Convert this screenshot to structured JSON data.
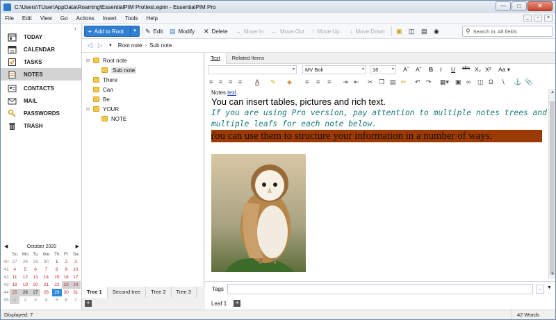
{
  "window": {
    "title": "C:\\Users\\TUser\\AppData\\Roaming\\EssentialPIM Pro\\test.epim - EssentialPIM Pro"
  },
  "menu": [
    "File",
    "Edit",
    "View",
    "Go",
    "Actions",
    "Insert",
    "Tools",
    "Help"
  ],
  "nav": [
    {
      "label": "TODAY",
      "icon": "today-icon"
    },
    {
      "label": "CALENDAR",
      "icon": "calendar-icon"
    },
    {
      "label": "TASKS",
      "icon": "tasks-icon"
    },
    {
      "label": "NOTES",
      "icon": "notes-icon"
    },
    {
      "label": "CONTACTS",
      "icon": "contacts-icon"
    },
    {
      "label": "MAIL",
      "icon": "mail-icon"
    },
    {
      "label": "PASSWORDS",
      "icon": "passwords-icon"
    },
    {
      "label": "TRASH",
      "icon": "trash-icon"
    }
  ],
  "calendar": {
    "title": "October  2020",
    "dow": [
      "Su",
      "Mo",
      "Tu",
      "We",
      "Th",
      "Fr",
      "Sa"
    ],
    "weeks": [
      {
        "wk": "40",
        "days": [
          "27",
          "28",
          "29",
          "30",
          "1",
          "2",
          "3"
        ]
      },
      {
        "wk": "41",
        "days": [
          "4",
          "5",
          "6",
          "7",
          "8",
          "9",
          "10"
        ]
      },
      {
        "wk": "42",
        "days": [
          "11",
          "12",
          "13",
          "14",
          "15",
          "16",
          "17"
        ]
      },
      {
        "wk": "43",
        "days": [
          "18",
          "19",
          "20",
          "21",
          "22",
          "23",
          "24"
        ]
      },
      {
        "wk": "44",
        "days": [
          "25",
          "26",
          "27",
          "28",
          "29",
          "30",
          "31"
        ]
      },
      {
        "wk": "45",
        "days": [
          "1",
          "2",
          "3",
          "4",
          "5",
          "6",
          "7"
        ]
      }
    ],
    "today": "29"
  },
  "toolbar": {
    "add_root": "Add to Root",
    "edit": "Edit",
    "modify": "Modify",
    "delete": "Delete",
    "move_in": "Move In",
    "move_out": "Move Out",
    "move_up": "Move Up",
    "move_down": "Move Down",
    "search_placeholder": "Search in: All fields"
  },
  "breadcrumb": [
    "Root note",
    "Sub note"
  ],
  "tree": [
    {
      "label": "Root note",
      "level": 0,
      "expanded": true
    },
    {
      "label": "Sub note",
      "level": 1,
      "selected": true
    },
    {
      "label": "There",
      "level": 0
    },
    {
      "label": "Can",
      "level": 0
    },
    {
      "label": "Be",
      "level": 0
    },
    {
      "label": "YOUR",
      "level": 0,
      "expanded": true
    },
    {
      "label": "NOTE",
      "level": 1
    }
  ],
  "tree_tabs": [
    "Tree 1",
    "Second tree",
    "Tree 2",
    "Tree 3"
  ],
  "editor": {
    "tabs": [
      "Text",
      "Related Items"
    ],
    "font": "MV Boli",
    "size": "16",
    "doc": {
      "line1_prefix": "Notes ",
      "line1_link": "text",
      "line1_suffix": ".",
      "line2": "You can insert tables, pictures and rich text.",
      "line3": "If you are using Pro version, pay attention to multiple notes trees and multiple leafs for each note below.",
      "line4": "You can use them to structure your information in a number of ways."
    },
    "tags_label": "Tags",
    "leaf": "Leaf 1"
  },
  "status": {
    "left": "Displayed: 7",
    "right": "42 Words"
  },
  "colors": {
    "accent": "#2f7fd3",
    "highlight_bg": "#9c3a06",
    "teal_text": "#1b7a7a"
  }
}
